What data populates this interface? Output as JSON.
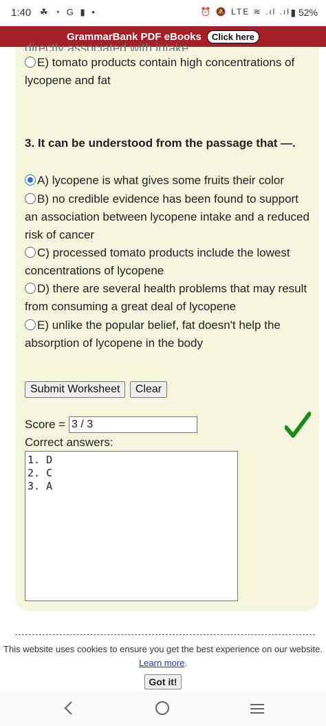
{
  "status": {
    "time": "1:40",
    "left_icons": "☘ ◔ G ▮ •",
    "right_icons": "⏰ 🔕 LTE ≋ .ıl .ıl",
    "battery": "▮ 52%"
  },
  "banner": {
    "title": "GrammarBank PDF eBooks",
    "button_label": "Click here"
  },
  "prev_question": {
    "partial_text": "directly associated with intake",
    "option_e": "E) tomato products contain high concentrations of lycopene and fat"
  },
  "question3": {
    "title": "3. It can be understood from the passage that —.",
    "options": [
      "A) lycopene is what gives some fruits their color",
      "B) no credible evidence has been found to support an association between lycopene intake and a reduced risk of cancer",
      "C) processed tomato products include the lowest concentrations of lycopene",
      "D) there are several health problems that may result from consuming a great deal of lycopene",
      "E) unlike the popular belief, fat doesn't help the absorption of lycopene in the body"
    ],
    "selected": "A"
  },
  "actions": {
    "submit_label": "Submit Worksheet",
    "clear_label": "Clear"
  },
  "result": {
    "score_label": "Score =",
    "score_value": "3 / 3",
    "correct_label": "Correct answers:",
    "answers_text": "1. D\n2. C\n3. A",
    "check_color": "#1e8a1e"
  },
  "cookie": {
    "message_prefix": "This website uses cookies to ensure you get the best experience on our website.",
    "learn_more": "Learn more",
    "suffix": ".",
    "got_it": "Got it!"
  },
  "nav": {
    "back": "<",
    "menu": "≡"
  }
}
